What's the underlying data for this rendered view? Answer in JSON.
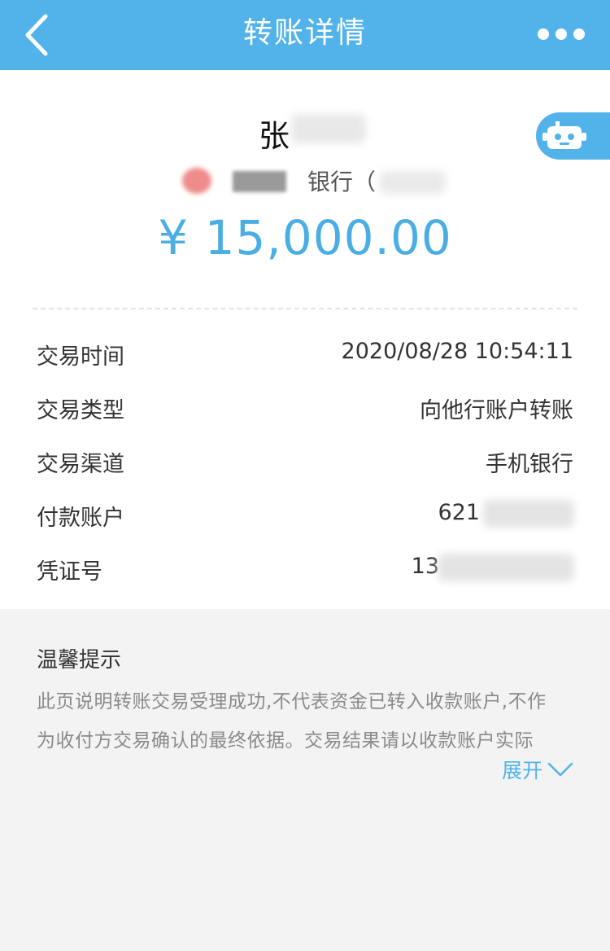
{
  "header": {
    "title": "转账详情",
    "back_icon": "chevron-left-icon",
    "more_icon": "more-dots-icon"
  },
  "payee": {
    "name_visible": "张",
    "bank_visible": "银行（",
    "amount": "¥ 15,000.00"
  },
  "assistant": {
    "icon": "robot-icon"
  },
  "details": {
    "time_label": "交易时间",
    "time_value": "2020/08/28 10:54:11",
    "type_label": "交易类型",
    "type_value": "向他行账户转账",
    "channel_label": "交易渠道",
    "channel_value": "手机银行",
    "account_label": "付款账户",
    "account_value": "621",
    "voucher_label": "凭证号",
    "voucher_value": "13"
  },
  "tips": {
    "title": "温馨提示",
    "line1": "此页说明转账交易受理成功,不代表资金已转入收款账户,不作",
    "line2": "为收付方交易确认的最终依据。交易结果请以收款账户实际",
    "expand_label": "展开"
  },
  "colors": {
    "header_bg": "#52b3ea",
    "amount": "#4aaee4",
    "page_bg": "#f3f3f3"
  }
}
